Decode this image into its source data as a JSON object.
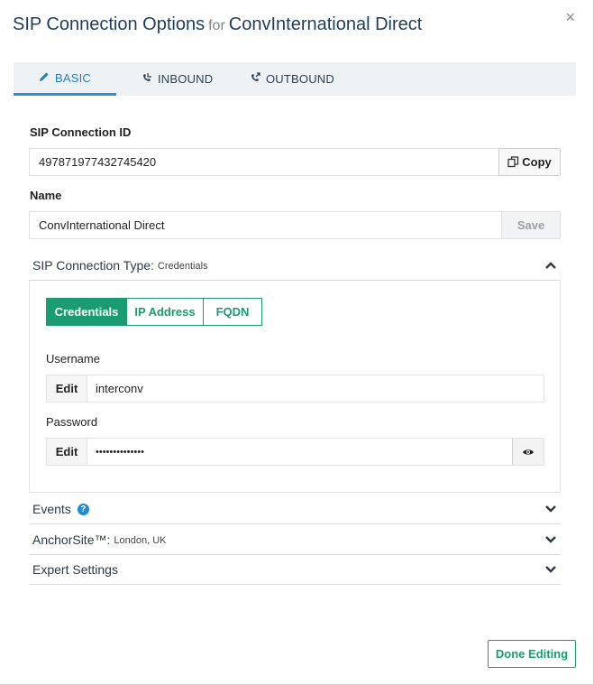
{
  "header": {
    "title_main": "SIP Connection Options",
    "title_for": "for",
    "title_name": "ConvInternational Direct",
    "close_glyph": "×"
  },
  "tabs": [
    {
      "label": "BASIC",
      "icon": "pencil-icon",
      "active": true
    },
    {
      "label": "INBOUND",
      "icon": "inbound-call-icon",
      "active": false
    },
    {
      "label": "OUTBOUND",
      "icon": "outbound-call-icon",
      "active": false
    }
  ],
  "connection_id": {
    "label": "SIP Connection ID",
    "value": "497871977432745420",
    "copy_label": "Copy"
  },
  "name": {
    "label": "Name",
    "value": "ConvInternational Direct",
    "save_label": "Save"
  },
  "connection_type": {
    "heading": "SIP Connection Type:",
    "current": "Credentials",
    "options": [
      "Credentials",
      "IP Address",
      "FQDN"
    ],
    "username_label": "Username",
    "username_value": "interconv",
    "password_label": "Password",
    "password_value": "••••••••••••••",
    "edit_label": "Edit"
  },
  "sections": {
    "events": "Events",
    "events_help": "?",
    "anchorsite": "AnchorSite™:",
    "anchorsite_value": "London, UK",
    "expert": "Expert Settings"
  },
  "footer": {
    "done_label": "Done Editing"
  },
  "colors": {
    "accent_green": "#1a9b72",
    "tab_blue": "#2c8fd6",
    "title_navy": "#1f3c5a"
  }
}
